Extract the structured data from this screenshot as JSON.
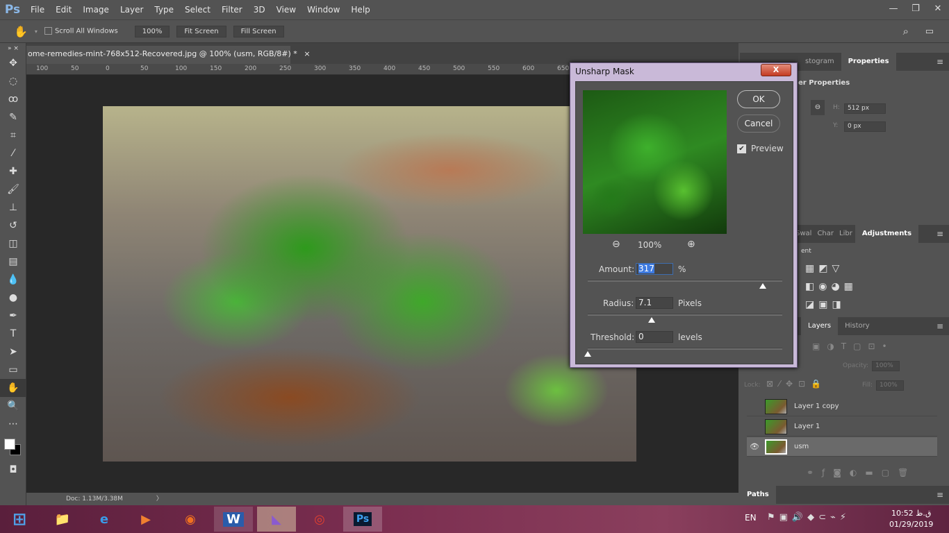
{
  "app": {
    "logo": "Ps"
  },
  "menu": [
    "File",
    "Edit",
    "Image",
    "Layer",
    "Type",
    "Select",
    "Filter",
    "3D",
    "View",
    "Window",
    "Help"
  ],
  "window_controls": {
    "minimize": "—",
    "restore": "❐",
    "close": "✕"
  },
  "options": {
    "scroll_all_windows": "Scroll All Windows",
    "zoom": "100%",
    "fit_screen": "Fit Screen",
    "fill_screen": "Fill Screen"
  },
  "document": {
    "tab_title": "ome-remedies-mint-768x512-Recovered.jpg @ 100% (usm, RGB/8#) *",
    "close": "×",
    "status": "Doc: 1.13M/3.38M"
  },
  "ruler": [
    "100",
    "50",
    "0",
    "50",
    "100",
    "150",
    "200",
    "250",
    "300",
    "350",
    "400",
    "450",
    "500",
    "550",
    "600",
    "650"
  ],
  "properties_panel": {
    "tabs": [
      "stogram",
      "Properties"
    ],
    "active": "Properties",
    "header": "er Properties",
    "h_label": "H:",
    "h_value": "512 px",
    "y_label": "Y:",
    "y_value": "0 px"
  },
  "adjustments_panel": {
    "tabs": [
      "Swal",
      "Char",
      "Libr",
      "Adjustments"
    ],
    "active": "Adjustments",
    "header": "ent"
  },
  "layers_panel": {
    "tabs": [
      "Layers",
      "History"
    ],
    "active": "Layers",
    "opacity_label": "Opacity:",
    "opacity": "100%",
    "lock_label": "Lock:",
    "fill_label": "Fill:",
    "fill": "100%",
    "layers": [
      {
        "name": "Layer 1 copy",
        "visible": false
      },
      {
        "name": "Layer 1",
        "visible": false
      },
      {
        "name": "usm",
        "visible": true,
        "selected": true
      }
    ]
  },
  "paths_panel": {
    "tab": "Paths"
  },
  "dialog": {
    "title": "Unsharp Mask",
    "close": "X",
    "ok": "OK",
    "cancel": "Cancel",
    "preview_label": "Preview",
    "preview_checked": true,
    "zoom": "100%",
    "amount_label": "Amount:",
    "amount": "317",
    "amount_unit": "%",
    "amount_fraction": 0.9,
    "radius_label": "Radius:",
    "radius": "7.1",
    "radius_unit": "Pixels",
    "radius_fraction": 0.33,
    "threshold_label": "Threshold:",
    "threshold": "0",
    "threshold_unit": "levels",
    "threshold_fraction": 0
  },
  "taskbar": {
    "lang": "EN",
    "time": "10:52 ق.ظ",
    "date": "01/29/2019"
  }
}
